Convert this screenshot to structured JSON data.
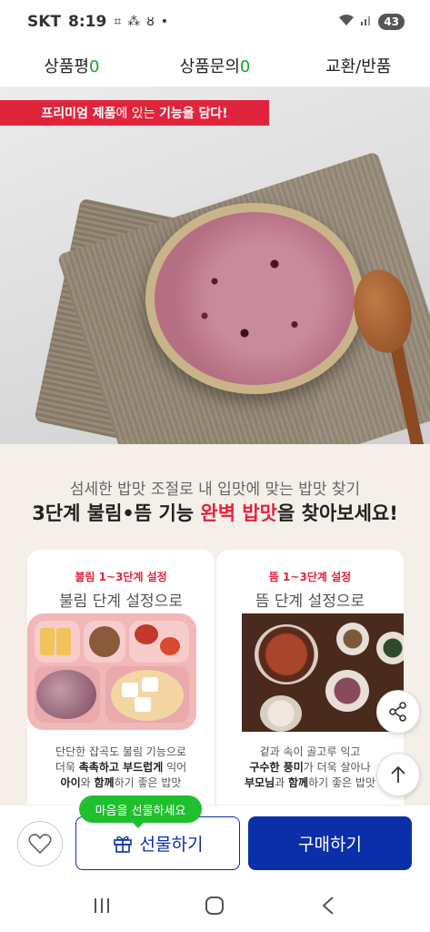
{
  "status_bar": {
    "carrier": "SKT",
    "time": "8:19",
    "battery": "43"
  },
  "tabs": [
    {
      "label": "상품평",
      "count": "0"
    },
    {
      "label": "상품문의",
      "count": "0"
    },
    {
      "label": "교환/반품",
      "count": ""
    }
  ],
  "hero": {
    "banner_prefix": "프리미엄 제품",
    "banner_mid": "에 있는 ",
    "banner_bold": "기능을 담다!"
  },
  "section": {
    "sub": "섬세한 밥맛 조절로 내 입맛에 맞는 밥맛 찾기",
    "headline_pre": "3단계 불림•뜸 기능 ",
    "headline_hl": "완벽 밥맛",
    "headline_post": "을 찾아보세요!"
  },
  "cards": [
    {
      "tag": "불림 1~3단계 설정",
      "title": "불림 단계 설정으로",
      "line1": "단단한 잡곡도 불림 기능으로",
      "line2_pre": "더욱 ",
      "line2_b1": "촉촉하고 부드럽게",
      "line2_post": " 익어",
      "line3_b1": "아이",
      "line3_mid": "와 ",
      "line3_b2": "함께",
      "line3_post": "하기 좋은 밥맛"
    },
    {
      "tag": "뜸 1~3단계 설정",
      "title": "뜸 단계 설정으로",
      "line1": "겉과 속이 골고루 익고",
      "line2_pre": "",
      "line2_b1": "구수한 풍미",
      "line2_post": "가 더욱 살아나",
      "line3_b1": "부모님",
      "line3_mid": "과 ",
      "line3_b2": "함께",
      "line3_post": "하기 좋은 밥맛"
    }
  ],
  "bottom": {
    "gift_tip": "마음을 선물하세요",
    "gift_label": "선물하기",
    "buy_label": "구매하기"
  },
  "colors": {
    "accent_red": "#e0243c",
    "primary_blue": "#0a2fa8",
    "tip_green": "#1fbf2e",
    "count_green": "#19a02a"
  }
}
